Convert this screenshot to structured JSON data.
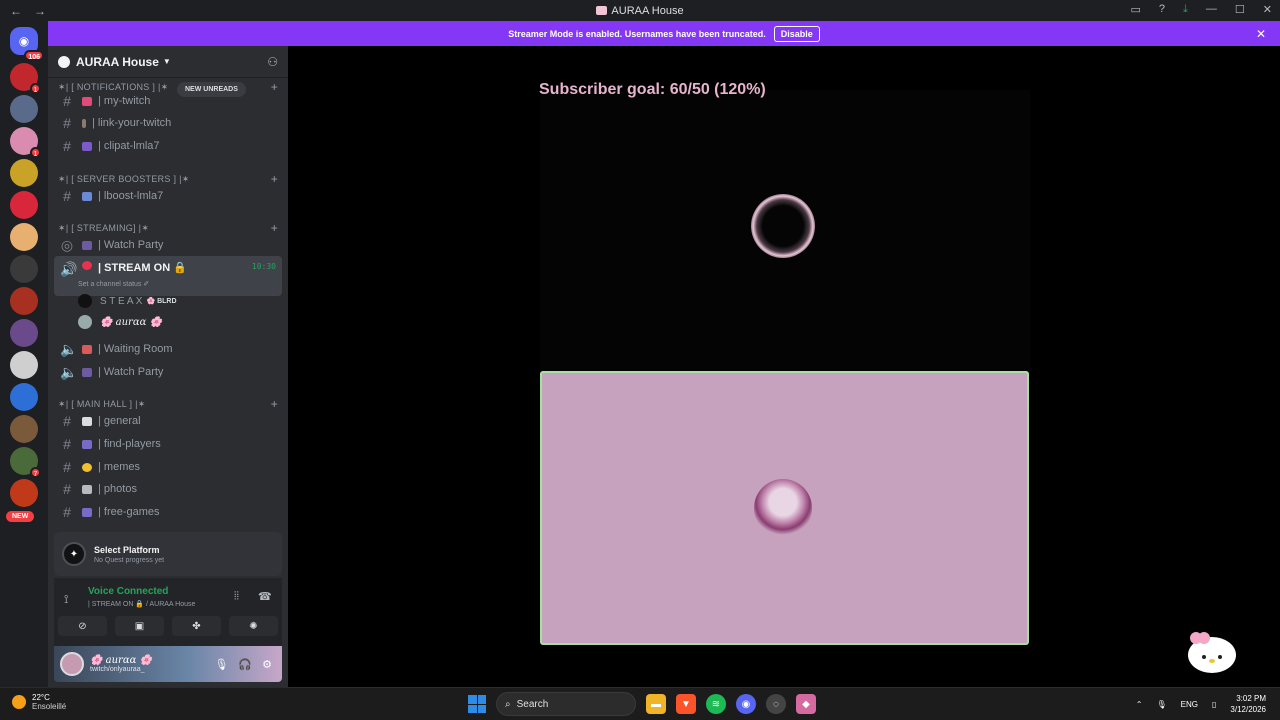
{
  "window": {
    "title": "AURAA House",
    "nav": {
      "back": "←",
      "forward": "→"
    },
    "controls": {
      "inbox": "▭",
      "help": "?",
      "download": "⤓",
      "minimize": "—",
      "maximize": "☐",
      "close": "✕"
    }
  },
  "guilds": {
    "home_badge": "106",
    "new_label": "NEW",
    "items": [
      {
        "color": "#c1272d",
        "badge": "1"
      },
      {
        "color": "#5a6a8a",
        "badge": ""
      },
      {
        "color": "#d98cb0",
        "badge": "1"
      },
      {
        "color": "#c9a227",
        "badge": ""
      },
      {
        "color": "#d8263a",
        "badge": ""
      },
      {
        "color": "#e8b070",
        "badge": ""
      },
      {
        "color": "#3a3a3a",
        "badge": ""
      },
      {
        "color": "#a83020",
        "badge": ""
      },
      {
        "color": "#6a4a8a",
        "badge": ""
      },
      {
        "color": "#cfcfcf",
        "badge": ""
      },
      {
        "color": "#2d6fd6",
        "badge": ""
      },
      {
        "color": "#7a5a3a",
        "badge": ""
      },
      {
        "color": "#4a6a3a",
        "badge": "7"
      },
      {
        "color": "#c03a1a",
        "badge": ""
      }
    ]
  },
  "banner": {
    "text": "Streamer Mode is enabled. Usernames have been truncated.",
    "disable": "Disable",
    "close": "✕"
  },
  "server": {
    "name": "AURAA House",
    "new_unreads": "NEW UNREADS",
    "categories": {
      "notifications": "✶| [ NOTIFICATIONS ] |✶",
      "boosters": "✶| [ SERVER BOOSTERS ] |✶",
      "streaming": "✶| [ STREAMING] |✶",
      "mainhall": "✶| [ MAIN HALL ] |✶"
    },
    "channels": {
      "my_twitch": "| my-twitch",
      "link_twitch": "| link-your-twitch",
      "clipat": "| clipat-lmla7",
      "lboost": "| lboost-lmla7",
      "watch_party_1": "| Watch Party",
      "stream_on": "| STREAM ON 🔒",
      "stream_timer": "10:30",
      "stream_status": "Set a channel status ✐",
      "waiting_room": "| Waiting Room",
      "watch_party_2": "| Watch Party",
      "general": "| general",
      "find_players": "| find-players",
      "memes": "| memes",
      "photos": "| photos",
      "free_games": "| free-games"
    },
    "voice_users": [
      {
        "name": "S T E A X",
        "tag": "🌸 BLRD"
      },
      {
        "name": "🌸 aurαα 🌸",
        "tag": ""
      }
    ]
  },
  "quest": {
    "title": "Select Platform",
    "subtitle": "No Quest progress yet"
  },
  "voice": {
    "status": "Voice Connected",
    "channel": "| STREAM ON 🔒 / AURAA House"
  },
  "user": {
    "name": "🌸 aurαα 🌸",
    "status": "twitch/onlyauraa_"
  },
  "stage": {
    "goal": "Subscriber goal: 60/50 (120%)"
  },
  "taskbar": {
    "temp": "22°C",
    "weather": "Ensoleillé",
    "search": "Search",
    "lang": "ENG",
    "time": "3:02 PM",
    "date": "3/12/2026"
  }
}
